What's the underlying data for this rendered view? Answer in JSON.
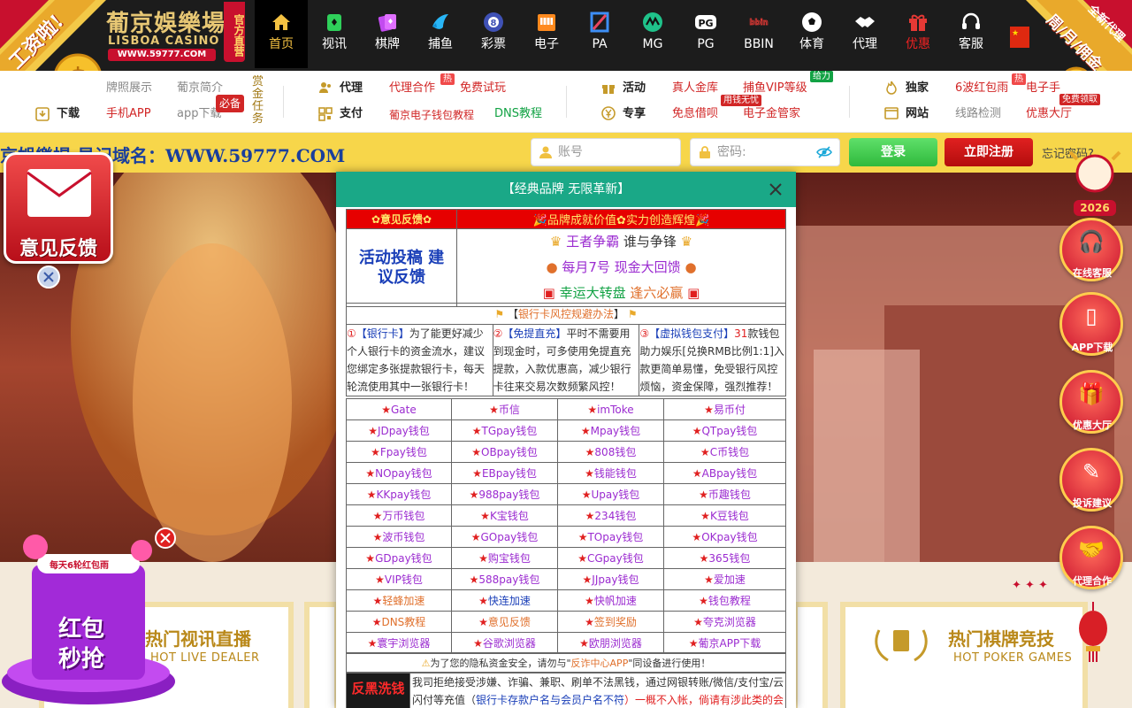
{
  "header": {
    "logo_cn": "葡京娛樂場",
    "logo_en": "LISBOA CASINO",
    "logo_url": "WWW.59777.COM",
    "logo_badge": "官方直营",
    "left_ribbon": "工资啦!",
    "right_ribbon": "周/月/佣金",
    "right_ribbon_tag": "全新代理",
    "flag_icon": "china-flag-icon",
    "nav": [
      {
        "label": "首页",
        "icon": "home-icon",
        "active": true
      },
      {
        "label": "视讯",
        "icon": "live-cards-icon"
      },
      {
        "label": "棋牌",
        "icon": "poker-cards-icon"
      },
      {
        "label": "捕鱼",
        "icon": "fish-icon"
      },
      {
        "label": "彩票",
        "icon": "lottery-ball-icon"
      },
      {
        "label": "电子",
        "icon": "slot-machine-icon"
      },
      {
        "label": "PA",
        "icon": "pa-logo-icon"
      },
      {
        "label": "MG",
        "icon": "mg-logo-icon"
      },
      {
        "label": "PG",
        "icon": "pg-logo-icon"
      },
      {
        "label": "BBIN",
        "icon": "bbin-logo-icon"
      },
      {
        "label": "体育",
        "icon": "soccer-ball-icon"
      },
      {
        "label": "代理",
        "icon": "handshake-icon"
      },
      {
        "label": "优惠",
        "icon": "gift-icon"
      },
      {
        "label": "客服",
        "icon": "headset-icon"
      }
    ]
  },
  "subnav": {
    "col1": {
      "license": "牌照展示",
      "intro": "葡京简介",
      "download": "下载",
      "app": "手机APP",
      "app_download": "app下载",
      "must_win": "必备",
      "bounty": "赏金任务"
    },
    "col2": {
      "agent": "代理",
      "agent_coop": "代理合作",
      "hot_tag": "热",
      "free_trial": "免费试玩",
      "pay": "支付",
      "wallet_tutorial": "葡京电子钱包教程",
      "dns_tutorial": "DNS教程"
    },
    "col3": {
      "activity": "活动",
      "real_vault": "真人金库",
      "fish_vip": "捕鱼VIP等级",
      "fish_tag": "给力",
      "exclusive": "专享",
      "free_loan": "免息借呗",
      "loan_tag": "用钱无忧",
      "gold_manager": "电子金管家"
    },
    "col4": {
      "exclusive_sole": "独家",
      "red_packet": "6波红包雨",
      "hot_tag": "热",
      "electronic_hand": "电子手",
      "website": "网站",
      "line_check": "线路检测",
      "promo_hall": "优惠大厅",
      "free_tag": "免费领取"
    }
  },
  "login": {
    "marquee": "京娛樂場  易记域名：WWW.59777.COM",
    "account_placeholder": "账号",
    "password_placeholder": "密码:",
    "login_button": "登录",
    "register_button": "立即注册",
    "forgot": "忘记密码?"
  },
  "feedback_widget": {
    "label": "意见反馈"
  },
  "redpacket_widget": {
    "top": "每天6轮红包雨",
    "line1": "红包",
    "line2": "秒抢"
  },
  "sidebar": [
    {
      "label": "在线客服",
      "icon": "headset-icon"
    },
    {
      "label": "APP下载",
      "icon": "phone-icon"
    },
    {
      "label": "优惠大厅",
      "icon": "gift-icon"
    },
    {
      "label": "投诉建议",
      "icon": "clipboard-icon"
    },
    {
      "label": "代理合作",
      "icon": "handshake-icon"
    }
  ],
  "sidebar_year": "2026",
  "cards": [
    {
      "title": "热门视讯直播",
      "subtitle": "HOT LIVE DEALER"
    },
    {
      "title": "热门棋牌竞技",
      "subtitle": "HOT POKER GAMES"
    }
  ],
  "modal": {
    "title": "【经典品牌 无限革新】",
    "feedback_header": "✿意见反馈✿",
    "brand_header": "品牌成就价值✿实力创造辉煌",
    "activity_title": "活动投稿 建议反馈",
    "king_pre": "王者争霸",
    "king_post": " 谁与争锋",
    "monthly": "每月7号 现金大回馈",
    "wheel_pre": "幸运大转盘",
    "wheel_post": " 逢六必赢",
    "risk_pre": "【",
    "risk_link": "银行卡风控规避办法",
    "risk_post": "】",
    "tip1_num": "①",
    "tip1_title": "【银行卡】",
    "tip1_text": "为了能更好减少个人银行卡的资金流水，建议您绑定多张提款银行卡，每天轮流使用其中一张银行卡！",
    "tip2_num": "②",
    "tip2_title": "【免提直充】",
    "tip2_text": "平时不需要用到现金时，可多使用免提直充提款，入款优惠高，减少银行卡往来交易次数频繁风控！",
    "tip3_num": "③",
    "tip3_title": "【虚拟钱包支付】",
    "tip3_num2": "31",
    "tip3_text": "款钱包助力娱乐[兑换RMB比例1:1]入款更简单易懂，免受银行风控烦恼，资金保障，强烈推荐！",
    "wallet_rows": [
      [
        "Gate",
        "币信",
        "imToke",
        "易币付"
      ],
      [
        "JDpay钱包",
        "TGpay钱包",
        "Mpay钱包",
        "QTpay钱包"
      ],
      [
        "Fpay钱包",
        "OBpay钱包",
        "808钱包",
        "C币钱包"
      ],
      [
        "NOpay钱包",
        "EBpay钱包",
        "钱能钱包",
        "ABpay钱包"
      ],
      [
        "KKpay钱包",
        "988pay钱包",
        "Upay钱包",
        "币趣钱包"
      ],
      [
        "万币钱包",
        "K宝钱包",
        "234钱包",
        "K豆钱包"
      ],
      [
        "波币钱包",
        "GOpay钱包",
        "TOpay钱包",
        "OKpay钱包"
      ],
      [
        "GDpay钱包",
        "购宝钱包",
        "CGpay钱包",
        "365钱包"
      ],
      [
        "VIP钱包",
        "588pay钱包",
        "JJpay钱包",
        "爱加速"
      ],
      [
        "轻蜂加速",
        "快连加速",
        "快帆加速",
        "钱包教程"
      ],
      [
        "DNS教程",
        "意见反馈",
        "签到奖励",
        "夸克浏览器"
      ],
      [
        "寰宇浏览器",
        "谷歌浏览器",
        "欧朋浏览器",
        "葡京APP下载"
      ]
    ],
    "privacy_pre": "为了您的隐私资金安全，请勿与\"",
    "privacy_link": "反诈中心APP",
    "privacy_post": "\"同设备进行使用！",
    "anti_title": "反黑洗钱",
    "anti_text1": "我司拒绝接受涉嫌、诈骗、兼职、刷单不法黑钱，通过网银转账/微信/支付宝/云闪付等充值（",
    "anti_link": "银行卡存款户名与会员户名不符",
    "anti_text2": "）一概不入帐，倘请有涉此类的会"
  }
}
